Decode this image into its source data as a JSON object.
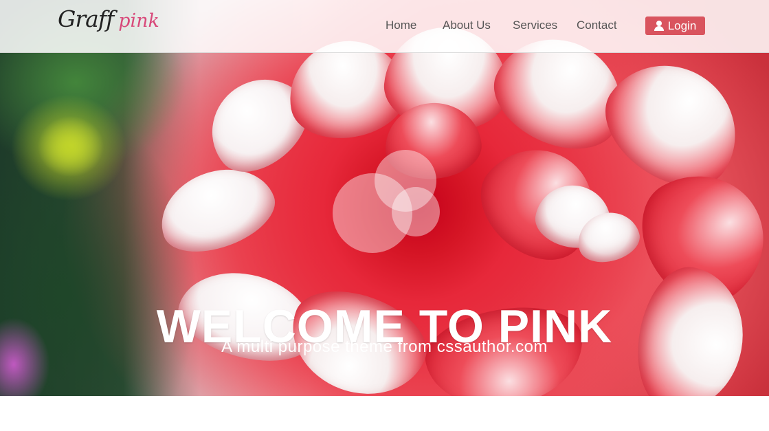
{
  "header": {
    "logo": {
      "main": "Graff",
      "accent": "pink"
    },
    "nav": [
      {
        "label": "Home"
      },
      {
        "label": "About Us"
      },
      {
        "label": "Services"
      },
      {
        "label": "Contact"
      }
    ],
    "login": {
      "label": "Login",
      "icon": "user-icon"
    }
  },
  "hero": {
    "title": "WELCOME TO PINK",
    "subtitle": "A multi purpose theme from cssauthor.com"
  },
  "colors": {
    "accent": "#d9545e",
    "logo_accent": "#d8497a",
    "nav_text": "#555555"
  }
}
